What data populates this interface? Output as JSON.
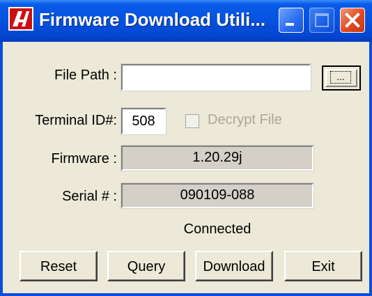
{
  "window": {
    "title": "Firmware Download Utili...",
    "icon": "app-logo-icon"
  },
  "titlebar_buttons": {
    "minimize_icon": "minimize-icon",
    "maximize_icon": "maximize-icon",
    "close_icon": "close-icon"
  },
  "form": {
    "file_path_label": "File Path :",
    "file_path_value": "",
    "browse_icon": "ellipsis-icon",
    "terminal_id_label": "Terminal ID#:",
    "terminal_id_value": "508",
    "decrypt_label": "Decrypt File",
    "decrypt_checked": false,
    "firmware_label": "Firmware :",
    "firmware_value": "1.20.29j",
    "serial_label": "Serial # :",
    "serial_value": "090109-088"
  },
  "status": {
    "text": "Connected"
  },
  "buttons": {
    "reset": "Reset",
    "query": "Query",
    "download": "Download",
    "exit": "Exit"
  },
  "colors": {
    "titlebar": "#0552E0",
    "face": "#ECE9D8",
    "readonly": "#D4D0C8",
    "close": "#E04A22"
  }
}
